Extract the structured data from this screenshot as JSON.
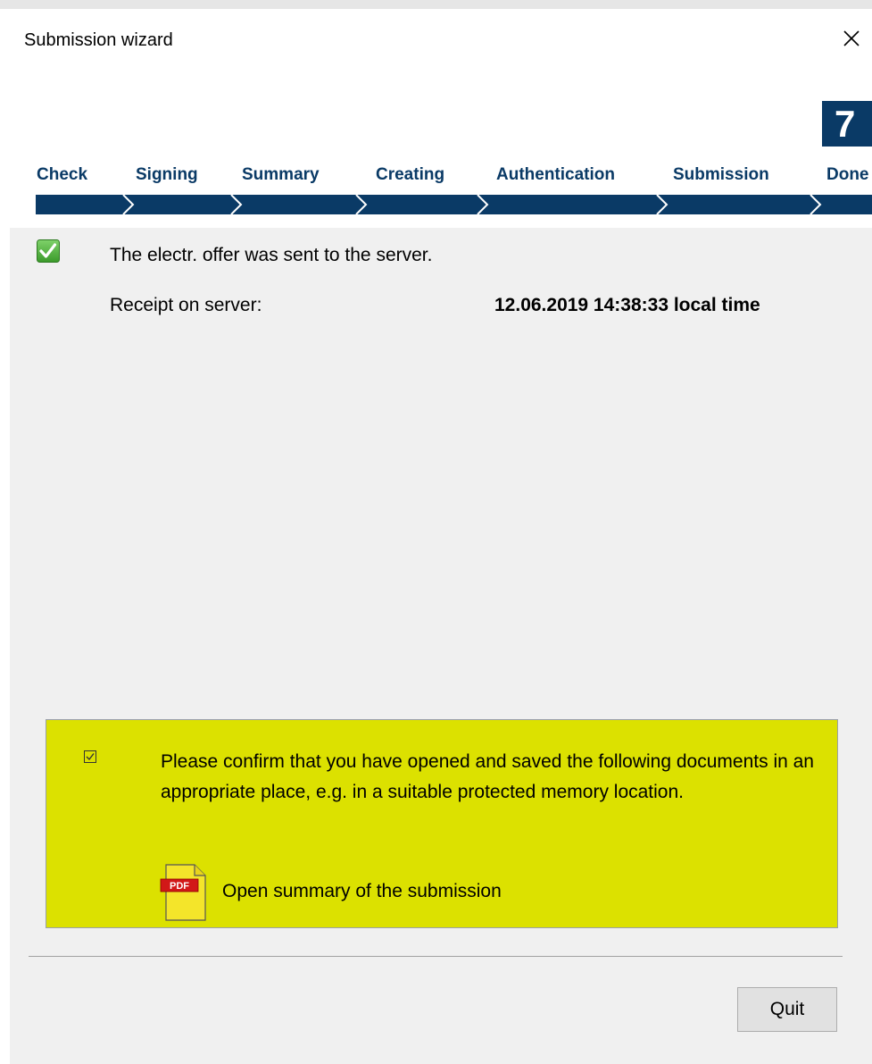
{
  "window": {
    "title": "Submission wizard",
    "close_icon": "close-icon"
  },
  "steps": {
    "current_number": "7",
    "items": [
      {
        "label": "Check"
      },
      {
        "label": "Signing"
      },
      {
        "label": "Summary"
      },
      {
        "label": "Creating"
      },
      {
        "label": "Authentication"
      },
      {
        "label": "Submission"
      },
      {
        "label": "Done"
      }
    ],
    "accent_color": "#0a3a66"
  },
  "status": {
    "icon": "check-icon",
    "message": "The electr. offer was sent to the server.",
    "receipt_label": "Receipt on server:",
    "receipt_value": "12.06.2019 14:38:33 local time",
    "icon_color": "#4caf3c"
  },
  "confirm": {
    "checked": true,
    "text": "Please confirm that you have opened and saved the following documents in an appropriate place, e.g. in a suitable protected memory location.",
    "pdf_icon_label": "PDF",
    "link_label": "Open summary of the submission",
    "background_color": "#dce100"
  },
  "footer": {
    "quit_label": "Quit"
  }
}
